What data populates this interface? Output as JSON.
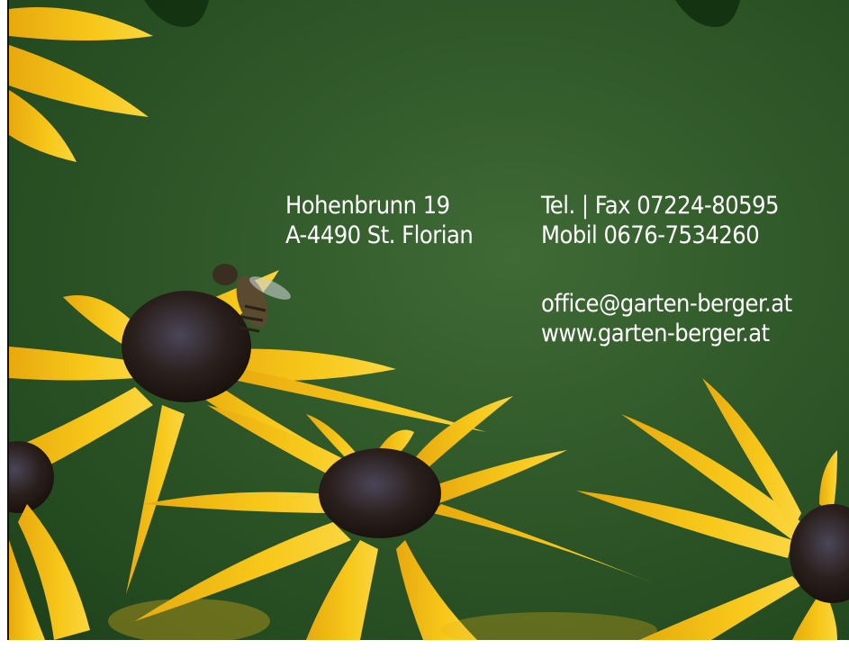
{
  "address": {
    "street": "Hohenbrunn 19",
    "city": "A-4490 St. Florian"
  },
  "phone": {
    "tel_fax": "Tel. | Fax 07224-80595",
    "mobile": "Mobil 0676-7534260"
  },
  "online": {
    "email": "office@garten-berger.at",
    "website": "www.garten-berger.at"
  },
  "colors": {
    "background_green": "#2f5728",
    "petal_yellow": "#f5c518",
    "flower_center": "#2a1a12",
    "text": "#ffffff"
  },
  "image_description_icon": "black-eyed-susan-flowers-with-bee"
}
